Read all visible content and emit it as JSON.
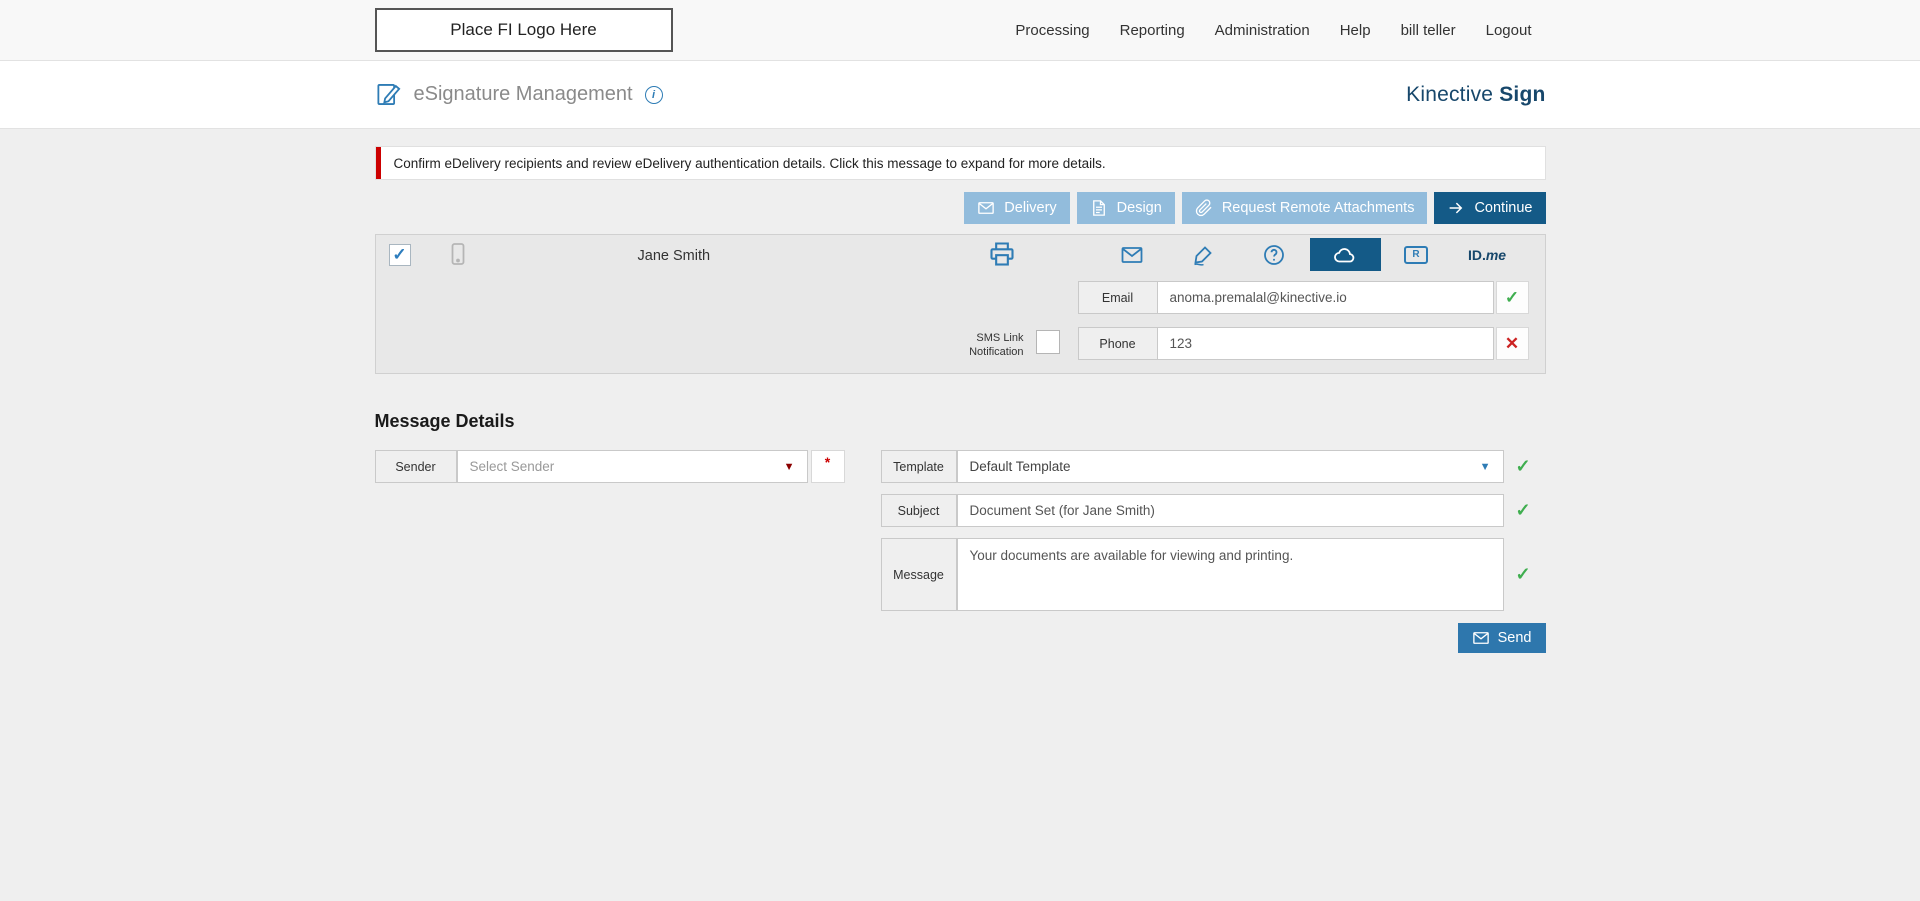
{
  "topnav": {
    "logo_text": "Place FI Logo Here",
    "items": [
      "Processing",
      "Reporting",
      "Administration",
      "Help",
      "bill teller",
      "Logout"
    ]
  },
  "header": {
    "title": "eSignature Management",
    "brand_name": "Kinective",
    "brand_product": "Sign"
  },
  "alert": {
    "message": "Confirm eDelivery recipients and review eDelivery authentication details. Click this message to expand for more details."
  },
  "toolbar": {
    "delivery": "Delivery",
    "design": "Design",
    "request_remote_attachments": "Request Remote Attachments",
    "continue": "Continue"
  },
  "recipient": {
    "name": "Jane Smith",
    "email_label": "Email",
    "email_value": "anoma.premalal@kinective.io",
    "sms_label": "SMS Link Notification",
    "phone_label": "Phone",
    "phone_value": "123",
    "idme_bold": "ID.",
    "idme_light": "me",
    "kiosk_letter": "R"
  },
  "message_details": {
    "heading": "Message Details",
    "sender_label": "Sender",
    "sender_placeholder": "Select Sender",
    "template_label": "Template",
    "template_value": "Default Template",
    "subject_label": "Subject",
    "subject_value": "Document Set (for Jane Smith)",
    "message_label": "Message",
    "message_value": "Your documents are available for viewing and printing.",
    "send_label": "Send"
  },
  "icons": {
    "check": "✓",
    "cross": "✕",
    "info": "i",
    "required": "*",
    "dropdown_arrow": "▼"
  },
  "colors": {
    "brand_navy": "#17476b",
    "icon_blue": "#2e7cb5",
    "light_button_blue": "#92bcdc",
    "dark_button_blue": "#145a87",
    "success_green": "#3fae4f",
    "error_red": "#cc2222",
    "alert_accent_red": "#cc0000"
  }
}
